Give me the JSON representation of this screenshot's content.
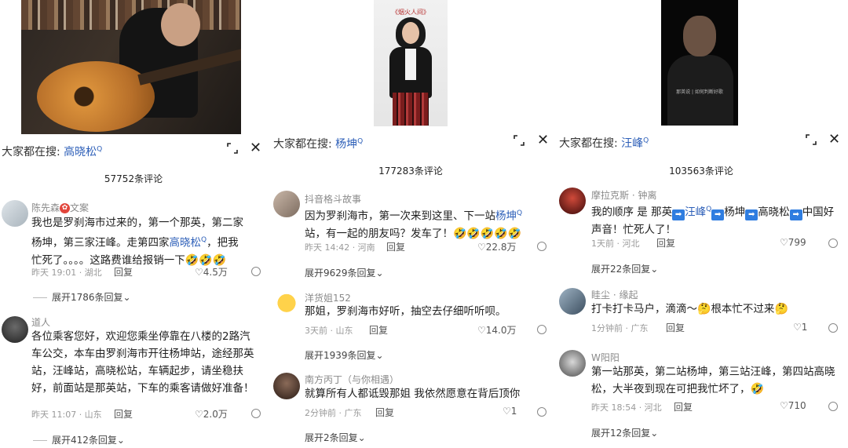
{
  "common": {
    "search_prefix": "大家都在搜:",
    "reply": "回复",
    "expand_arrow": "⌄",
    "close_glyph": "✕"
  },
  "panels": [
    {
      "search_keyword": "高晓松",
      "comment_count": "57752条评论",
      "comments": [
        {
          "user": "陈先森",
          "badge": "文案",
          "text_parts": [
            "我也是罗刹海市过来的，第一个那英，第二家杨坤，第三家汪峰。走第四家",
            "高晓松",
            "，把我忙死了。。。。这路费谁给报销一下"
          ],
          "emoji": "🤣🤣🤣",
          "time": "昨天 19:01 · 湖北",
          "likes": "4.5万",
          "expand": "展开1786条回复"
        },
        {
          "user": "道人",
          "text": "各位乘客您好，欢迎您乘坐停靠在八楼的2路汽车公交，本车由罗刹海市开往杨坤站，途经那英站，汪峰站，高晓松站，车辆起步，请坐稳扶好，前面站是那英站，下车的乘客请做好准备！",
          "time": "昨天 11:07 · 山东",
          "likes": "2.0万",
          "expand": "展开412条回复"
        }
      ]
    },
    {
      "search_keyword": "杨坤",
      "comment_count": "177283条评论",
      "video_title": "《烟火人间》",
      "comments": [
        {
          "user": "抖音格斗故事",
          "text_parts": [
            "因为罗刹海市，第一次来到这里、下一站",
            "杨坤",
            "站，有一起的朋友吗？发车了！"
          ],
          "emoji": "🤣🤣🤣🤣🤣",
          "time": "昨天 14:42 · 河南",
          "likes": "22.8万",
          "expand": "展开9629条回复"
        },
        {
          "user": "洋货姐152",
          "text": "那姐，罗刹海市好听，抽空去仔细听听呗。",
          "time": "3天前 · 山东",
          "likes": "14.0万",
          "expand": "展开1939条回复"
        },
        {
          "user": "南方丙丁（与你相遇）",
          "text": "就算所有人都诋毁那姐 我依然愿意在背后顶你",
          "time": "2分钟前 · 广东",
          "likes": "1",
          "expand": "展开2条回复"
        }
      ]
    },
    {
      "search_keyword": "汪峰",
      "comment_count": "103563条评论",
      "video_caption": "那英说 | 如何判断好歌",
      "comments": [
        {
          "user": "摩拉克斯 · 钟离",
          "text_parts": [
            "我的顺序 是 那英",
            "汪峰",
            "杨坤",
            "高晓松",
            "中国好声音！忙死人了！"
          ],
          "arrow": "➡",
          "time": "1天前 · 河北",
          "likes": "799",
          "expand": "展开22条回复"
        },
        {
          "user": "眭尘 · 缘起",
          "text_parts": [
            "打卡打卡马户，滴滴～",
            "根本忙不过来"
          ],
          "emoji_a": "🤔",
          "emoji_b": "🤔",
          "time": "1分钟前 · 广东",
          "likes": "1"
        },
        {
          "user": "W阳阳",
          "text": "第一站那英，第二站杨坤，第三站汪峰，第四站高晓松，大半夜到现在可把我忙坏了，",
          "emoji": "🤣",
          "time": "昨天 18:54 · 河北",
          "likes": "710",
          "expand": "展开12条回复"
        }
      ]
    }
  ]
}
